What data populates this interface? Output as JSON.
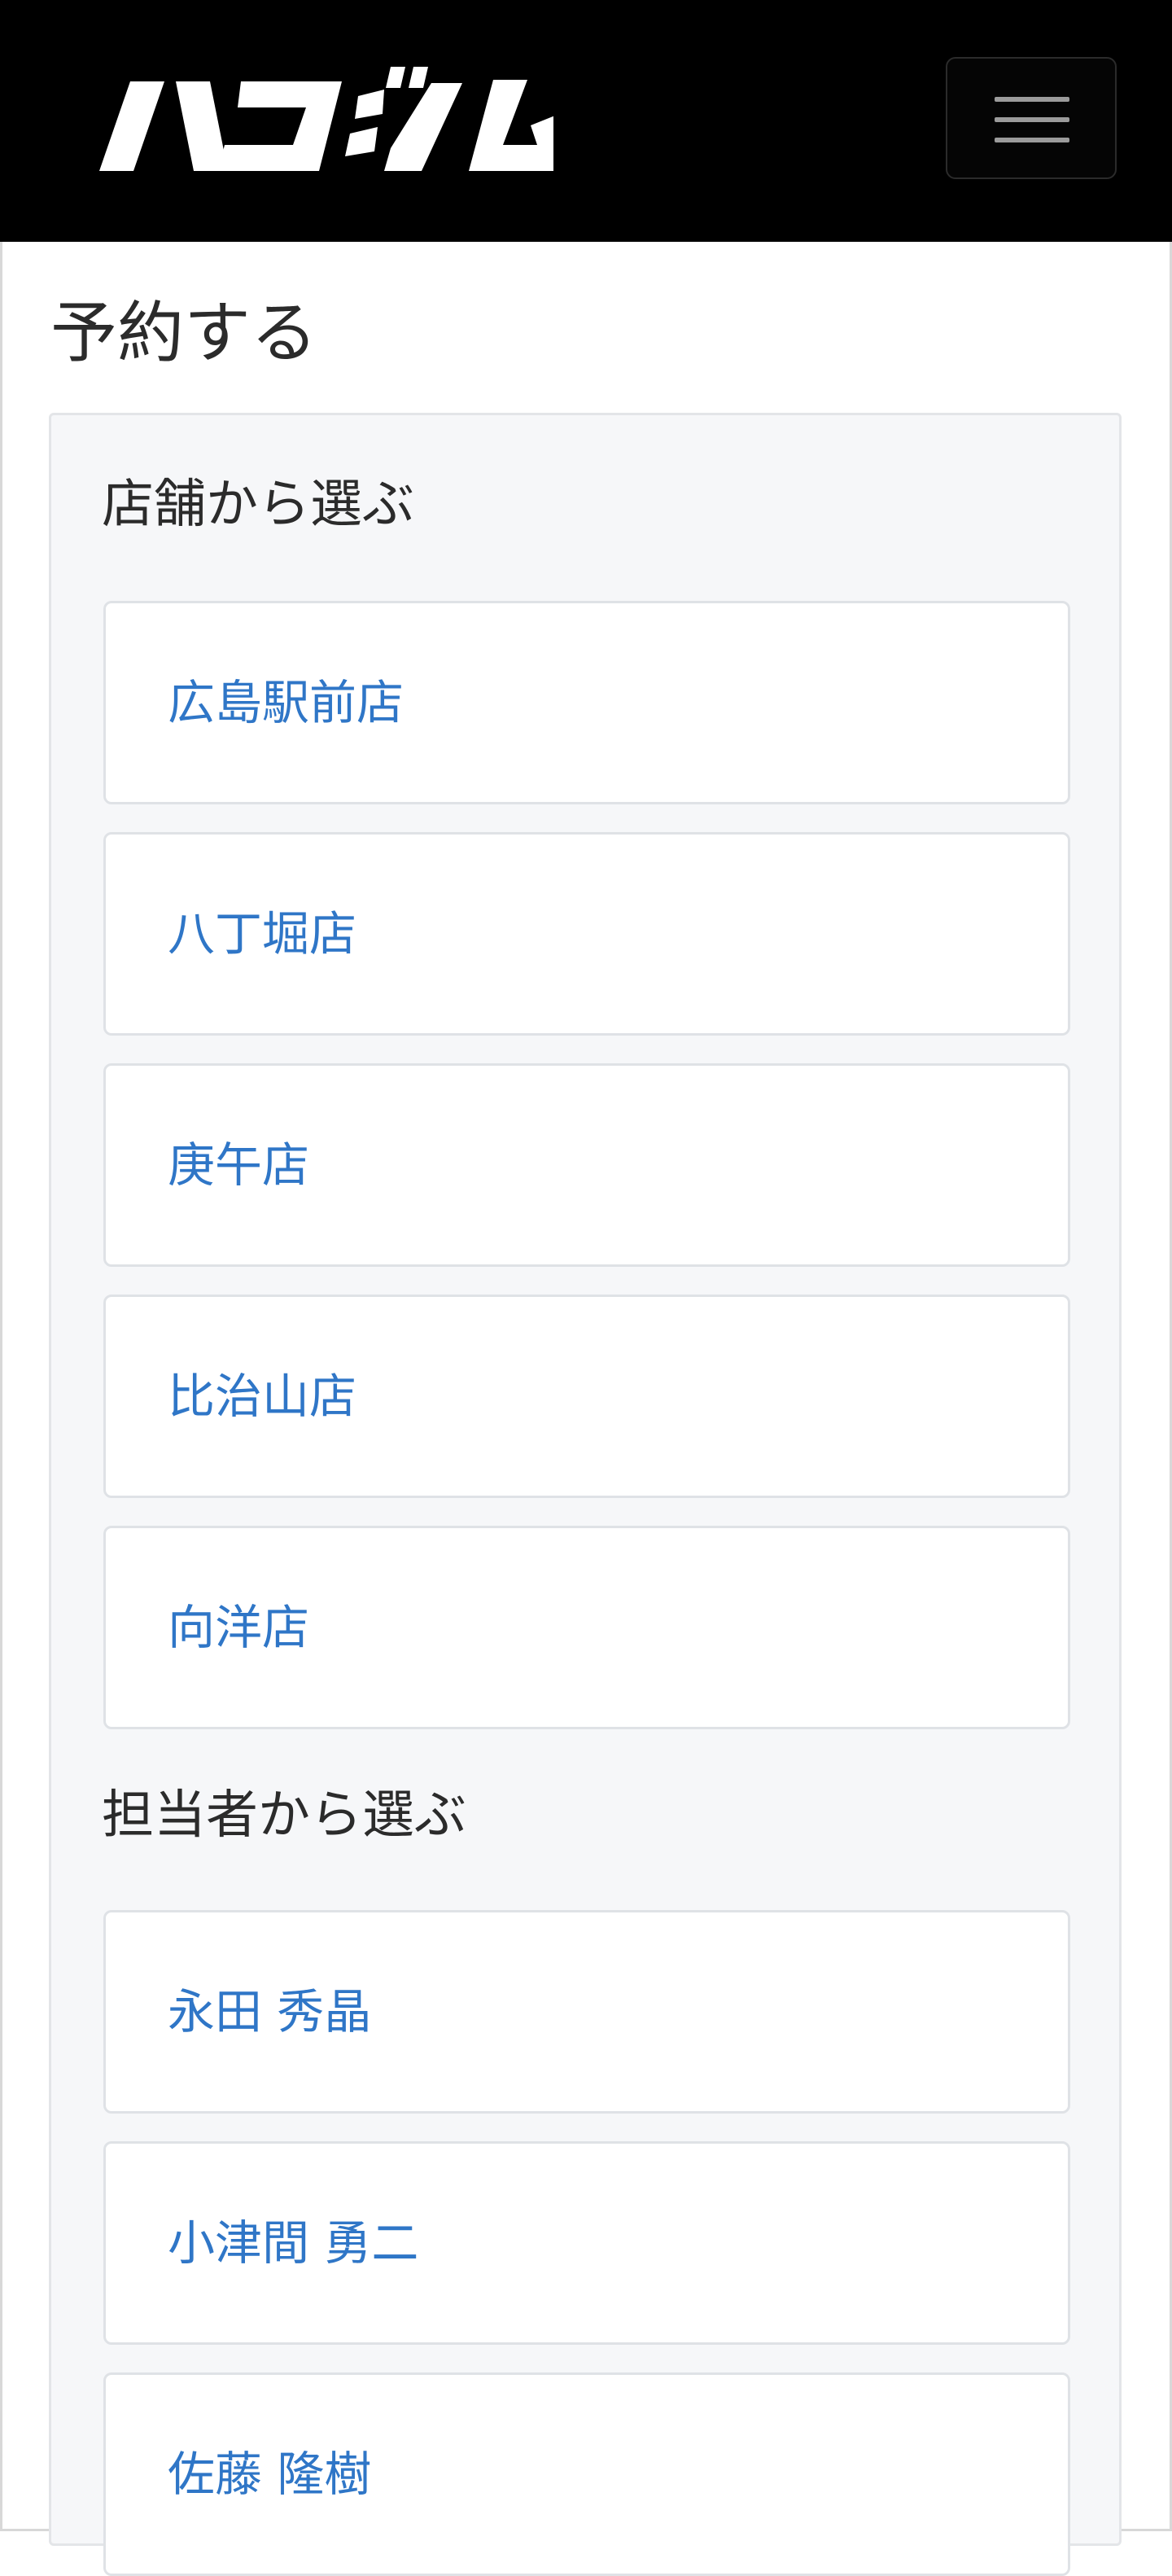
{
  "header": {
    "logo_text": "ハコジム",
    "menu_icon": "hamburger-icon"
  },
  "page": {
    "title": "予約する"
  },
  "stores": {
    "heading": "店舗から選ぶ",
    "items": [
      {
        "label": "広島駅前店"
      },
      {
        "label": "八丁堀店"
      },
      {
        "label": "庚午店"
      },
      {
        "label": "比治山店"
      },
      {
        "label": "向洋店"
      }
    ]
  },
  "staff": {
    "heading": "担当者から選ぶ",
    "items": [
      {
        "label": "永田 秀晶"
      },
      {
        "label": "小津間 勇二"
      },
      {
        "label": "佐藤 隆樹"
      }
    ]
  },
  "colors": {
    "link": "#2f76c7",
    "navbar_bg": "#000000",
    "panel_bg": "#f6f7f9"
  }
}
